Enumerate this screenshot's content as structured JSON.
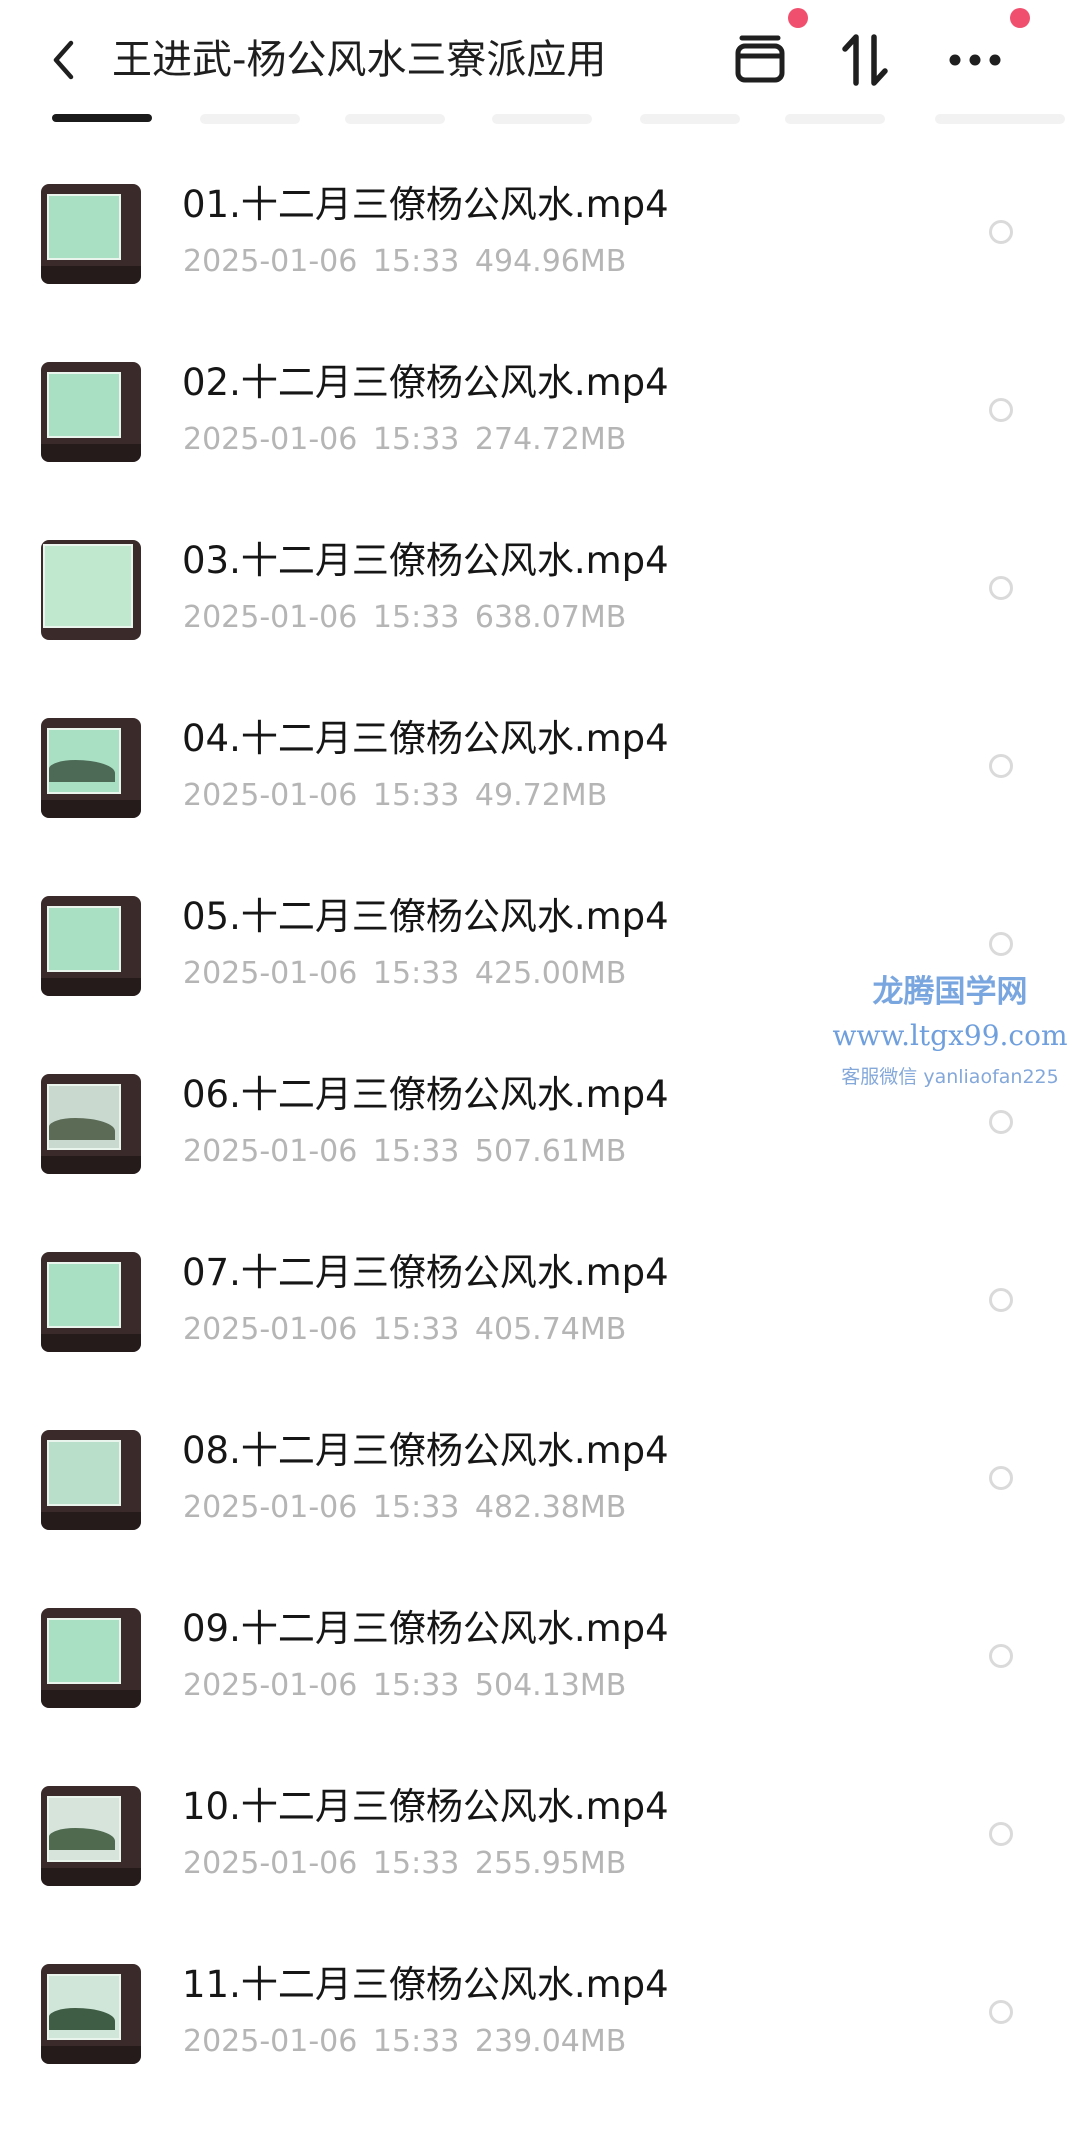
{
  "header": {
    "title": "王进武-杨公风水三寮派应用",
    "icons": [
      "back-icon",
      "archive-icon",
      "sort-icon",
      "more-icon"
    ],
    "badge_color": "#f0506e"
  },
  "files": [
    {
      "name": "01.十二月三僚杨公风水.mp4",
      "date": "2025-01-06",
      "time": "15:33",
      "size": "494.96MB"
    },
    {
      "name": "02.十二月三僚杨公风水.mp4",
      "date": "2025-01-06",
      "time": "15:33",
      "size": "274.72MB"
    },
    {
      "name": "03.十二月三僚杨公风水.mp4",
      "date": "2025-01-06",
      "time": "15:33",
      "size": "638.07MB"
    },
    {
      "name": "04.十二月三僚杨公风水.mp4",
      "date": "2025-01-06",
      "time": "15:33",
      "size": "49.72MB"
    },
    {
      "name": "05.十二月三僚杨公风水.mp4",
      "date": "2025-01-06",
      "time": "15:33",
      "size": "425.00MB"
    },
    {
      "name": "06.十二月三僚杨公风水.mp4",
      "date": "2025-01-06",
      "time": "15:33",
      "size": "507.61MB"
    },
    {
      "name": "07.十二月三僚杨公风水.mp4",
      "date": "2025-01-06",
      "time": "15:33",
      "size": "405.74MB"
    },
    {
      "name": "08.十二月三僚杨公风水.mp4",
      "date": "2025-01-06",
      "time": "15:33",
      "size": "482.38MB"
    },
    {
      "name": "09.十二月三僚杨公风水.mp4",
      "date": "2025-01-06",
      "time": "15:33",
      "size": "504.13MB"
    },
    {
      "name": "10.十二月三僚杨公风水.mp4",
      "date": "2025-01-06",
      "time": "15:33",
      "size": "255.95MB"
    },
    {
      "name": "11.十二月三僚杨公风水.mp4",
      "date": "2025-01-06",
      "time": "15:33",
      "size": "239.04MB"
    }
  ],
  "watermark": {
    "line1": "龙腾国学网",
    "line2": "www.ltgx99.com",
    "line3": "客服微信 yanliaofan225"
  }
}
